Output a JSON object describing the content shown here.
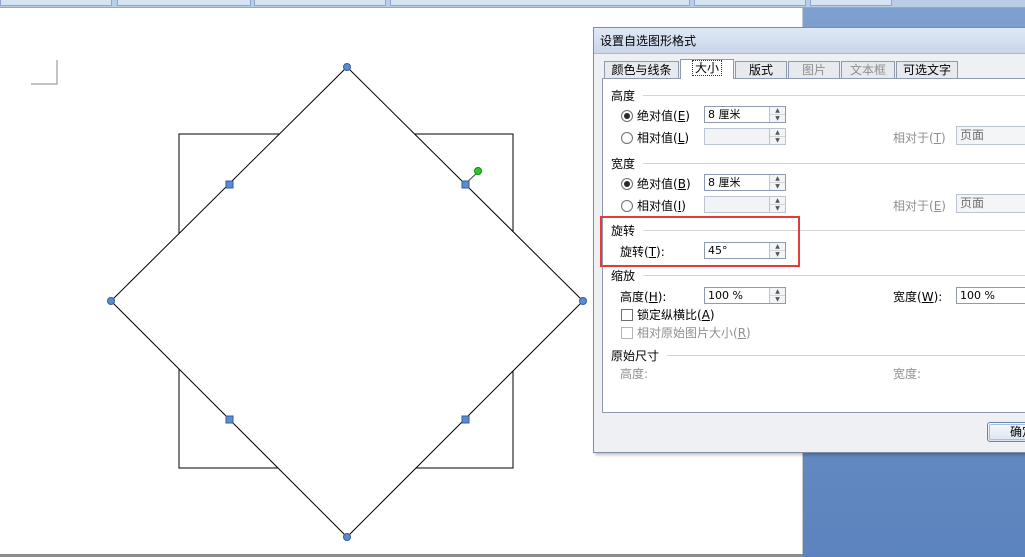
{
  "dialog": {
    "title": "设置自选图形格式",
    "tabs": [
      {
        "label": "颜色与线条",
        "state": "normal"
      },
      {
        "label": "大小",
        "state": "active"
      },
      {
        "label": "版式",
        "state": "normal"
      },
      {
        "label": "图片",
        "state": "disabled"
      },
      {
        "label": "文本框",
        "state": "disabled"
      },
      {
        "label": "可选文字",
        "state": "normal"
      }
    ],
    "height_group": {
      "title": "高度",
      "absolute_label": "绝对值",
      "absolute_key": "E",
      "absolute_value": "8 厘米",
      "relative_label": "相对值",
      "relative_key": "L",
      "relative_value": "",
      "relative_to_label": "相对于",
      "relative_to_key": "T",
      "relative_to_value": "页面"
    },
    "width_group": {
      "title": "宽度",
      "absolute_label": "绝对值",
      "absolute_key": "B",
      "absolute_value": "8 厘米",
      "relative_label": "相对值",
      "relative_key": "I",
      "relative_value": "",
      "relative_to_label": "相对于",
      "relative_to_key": "E",
      "relative_to_value": "页面"
    },
    "rotation_group": {
      "title": "旋转",
      "rotation_label": "旋转",
      "rotation_key": "T",
      "rotation_value": "45°"
    },
    "scale_group": {
      "title": "缩放",
      "height_label": "高度",
      "height_key": "H",
      "height_value": "100 %",
      "width_label": "宽度",
      "width_key": "W",
      "width_value": "100 %",
      "lock_aspect_label": "锁定纵横比",
      "lock_aspect_key": "A",
      "relative_original_label": "相对原始图片大小",
      "relative_original_key": "R"
    },
    "original_group": {
      "title": "原始尺寸",
      "height_label": "高度:",
      "width_label": "宽度:"
    },
    "ok_label": "确定"
  },
  "colors": {
    "highlight": "#e33b3b",
    "handle_blue": "#4f81bd",
    "rotate_handle": "#22cc22"
  }
}
